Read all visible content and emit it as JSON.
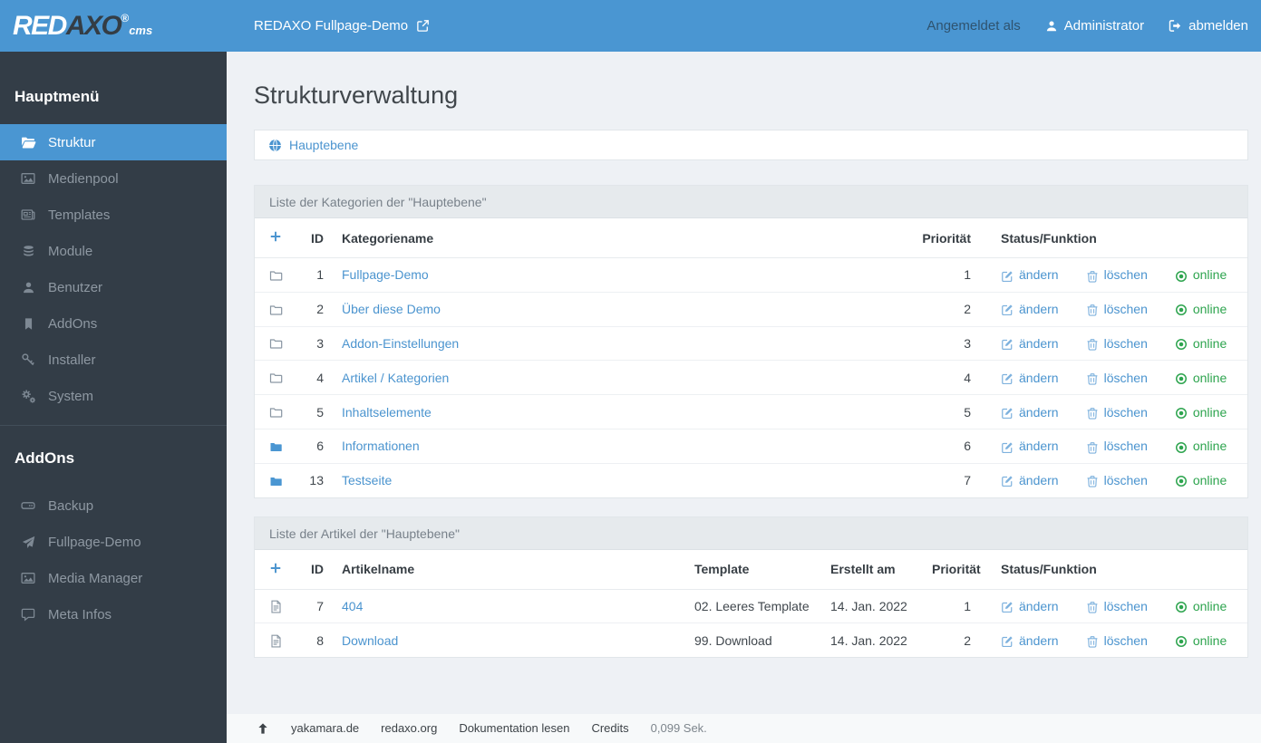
{
  "topbar": {
    "logo": {
      "red": "RED",
      "axo": "AXO",
      "reg": "®",
      "cms": "cms"
    },
    "site_link": "REDAXO Fullpage-Demo",
    "logged_in_as": "Angemeldet als",
    "user": "Administrator",
    "logout": "abmelden"
  },
  "sidebar": {
    "main_heading": "Hauptmenü",
    "main_items": [
      {
        "label": "Struktur",
        "icon": "folder-open-icon",
        "active": true
      },
      {
        "label": "Medienpool",
        "icon": "image-icon",
        "active": false
      },
      {
        "label": "Templates",
        "icon": "newspaper-icon",
        "active": false
      },
      {
        "label": "Module",
        "icon": "database-icon",
        "active": false
      },
      {
        "label": "Benutzer",
        "icon": "user-icon",
        "active": false
      },
      {
        "label": "AddOns",
        "icon": "bookmark-icon",
        "active": false
      },
      {
        "label": "Installer",
        "icon": "key-icon",
        "active": false
      },
      {
        "label": "System",
        "icon": "gears-icon",
        "active": false
      }
    ],
    "addons_heading": "AddOns",
    "addon_items": [
      {
        "label": "Backup",
        "icon": "hdd-icon"
      },
      {
        "label": "Fullpage-Demo",
        "icon": "paper-plane-icon"
      },
      {
        "label": "Media Manager",
        "icon": "image-icon"
      },
      {
        "label": "Meta Infos",
        "icon": "comment-icon"
      }
    ]
  },
  "page": {
    "title": "Strukturverwaltung"
  },
  "breadcrumb": {
    "root": "Hauptebene",
    "icon": "globe-icon"
  },
  "categories": {
    "panel_title": "Liste der Kategorien der \"Hauptebene\"",
    "headers": {
      "id": "ID",
      "name": "Kategoriename",
      "priority": "Priorität",
      "status": "Status/Funktion"
    },
    "rows": [
      {
        "id": "1",
        "name": "Fullpage-Demo",
        "priority": "1",
        "icon": "folder-outline-icon"
      },
      {
        "id": "2",
        "name": "Über diese Demo",
        "priority": "2",
        "icon": "folder-outline-icon"
      },
      {
        "id": "3",
        "name": "Addon-Einstellungen",
        "priority": "3",
        "icon": "folder-outline-icon"
      },
      {
        "id": "4",
        "name": "Artikel / Kategorien",
        "priority": "4",
        "icon": "folder-outline-icon"
      },
      {
        "id": "5",
        "name": "Inhaltselemente",
        "priority": "5",
        "icon": "folder-outline-icon"
      },
      {
        "id": "6",
        "name": "Informationen",
        "priority": "6",
        "icon": "folder-filled-icon"
      },
      {
        "id": "13",
        "name": "Testseite",
        "priority": "7",
        "icon": "folder-filled-icon"
      }
    ]
  },
  "articles": {
    "panel_title": "Liste der Artikel der \"Hauptebene\"",
    "headers": {
      "id": "ID",
      "name": "Artikelname",
      "template": "Template",
      "created": "Erstellt am",
      "priority": "Priorität",
      "status": "Status/Funktion"
    },
    "rows": [
      {
        "id": "7",
        "name": "404",
        "template": "02. Leeres Template",
        "created": "14. Jan. 2022",
        "priority": "1",
        "icon": "file-text-icon"
      },
      {
        "id": "8",
        "name": "Download",
        "template": "99. Download",
        "created": "14. Jan. 2022",
        "priority": "2",
        "icon": "file-text-icon"
      }
    ]
  },
  "actions": {
    "edit": "ändern",
    "delete": "löschen",
    "online": "online"
  },
  "footer": {
    "links": [
      "yakamara.de",
      "redaxo.org",
      "Dokumentation lesen",
      "Credits"
    ],
    "time": "0,099 Sek."
  },
  "colors": {
    "topbar_blue": "#4a96d2",
    "sidebar_dark": "#333d47",
    "active_item_blue": "#4a96d2",
    "link_blue": "#4b94cf",
    "online_green": "#2da44e",
    "content_background": "#eef1f5"
  }
}
